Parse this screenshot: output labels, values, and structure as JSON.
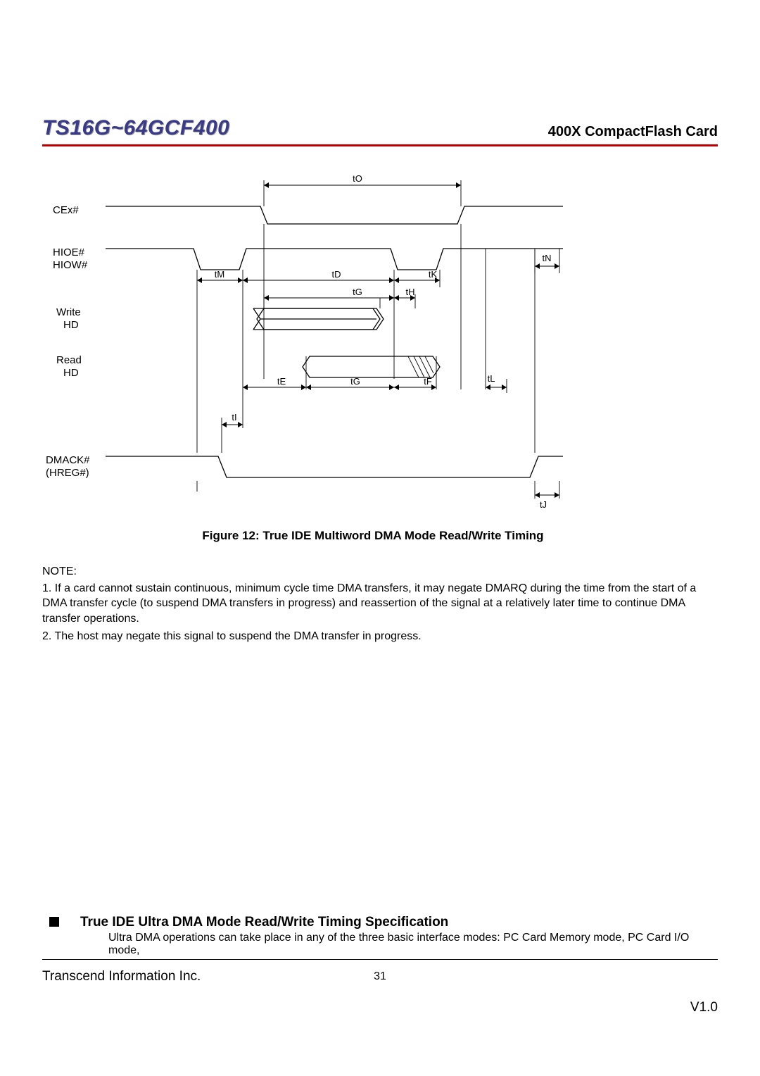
{
  "header": {
    "left_title": "TS16G~64GCF400",
    "right_title": "400X CompactFlash Card"
  },
  "diagram": {
    "signals": {
      "cex": "CEx#",
      "hioe": "HIOE#",
      "hiow": "HIOW#",
      "write_hd_1": "Write",
      "write_hd_2": "HD",
      "read_hd_1": "Read",
      "read_hd_2": "HD",
      "dmack_1": "DMACK#",
      "dmack_2": "(HREG#)"
    },
    "timings": {
      "tO": "tO",
      "tN": "tN",
      "tM": "tM",
      "tD": "tD",
      "tK": "tK",
      "tG_upper": "tG",
      "tH": "tH",
      "tE": "tE",
      "tG_lower": "tG",
      "tF": "tF",
      "tL": "tL",
      "tI": "tI",
      "tJ": "tJ"
    },
    "caption": "Figure 12: True IDE Multiword DMA Mode Read/Write Timing"
  },
  "notes": {
    "heading": "NOTE:",
    "items": [
      "1. If a card cannot sustain continuous, minimum cycle time DMA transfers, it may negate DMARQ during the time from the start of a DMA transfer cycle (to suspend DMA transfers in progress) and reassertion of the signal at a relatively later time to continue DMA transfer operations.",
      "2. The host may negate this signal to suspend the DMA transfer in progress."
    ]
  },
  "section": {
    "title": "True IDE Ultra DMA Mode Read/Write Timing Specification",
    "body": "Ultra DMA operations can take place in any of the three basic interface modes: PC Card Memory mode, PC Card I/O mode,"
  },
  "footer": {
    "company": "Transcend Information Inc.",
    "page": "31",
    "version": "V1.0"
  }
}
